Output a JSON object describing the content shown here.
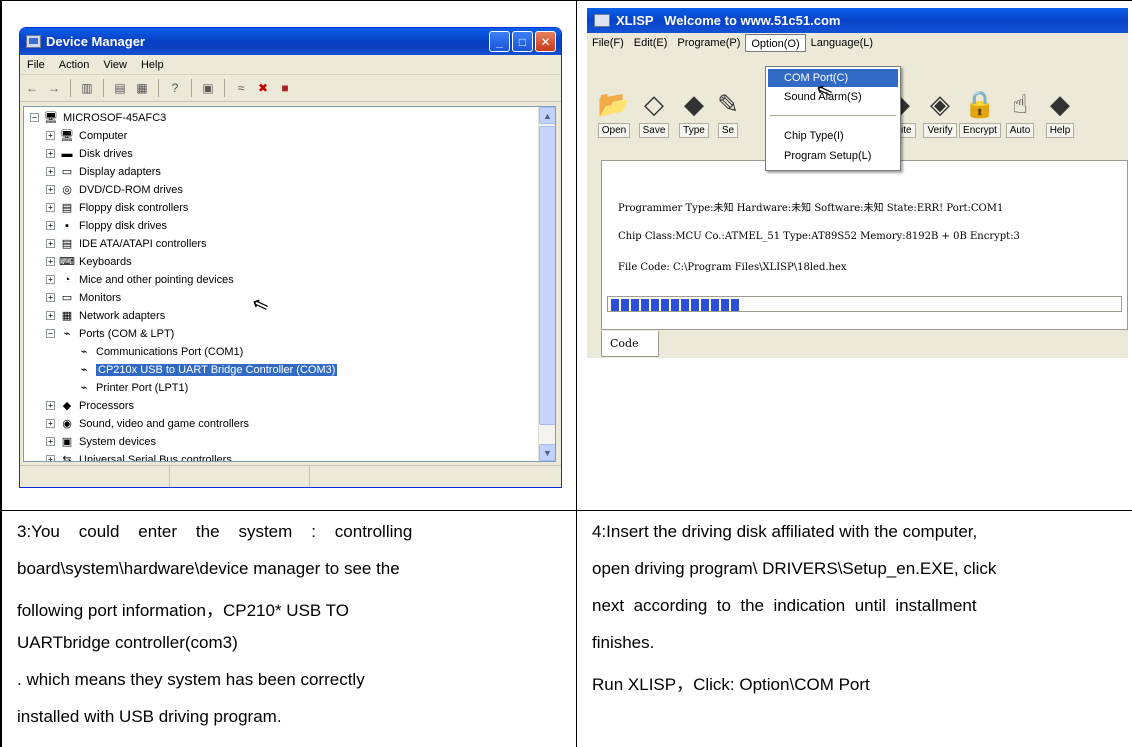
{
  "device_manager": {
    "title": "Device Manager",
    "menu": [
      "File",
      "Action",
      "View",
      "Help"
    ],
    "tree": {
      "root": "MICROSOF-45AFC3",
      "items": [
        {
          "label": "Computer",
          "icon": "computer-icon"
        },
        {
          "label": "Disk drives",
          "icon": "disk-icon"
        },
        {
          "label": "Display adapters",
          "icon": "monitor-icon"
        },
        {
          "label": "DVD/CD-ROM drives",
          "icon": "cd-icon"
        },
        {
          "label": "Floppy disk controllers",
          "icon": "controller-icon"
        },
        {
          "label": "Floppy disk drives",
          "icon": "floppy-icon"
        },
        {
          "label": "IDE ATA/ATAPI controllers",
          "icon": "controller-icon"
        },
        {
          "label": "Keyboards",
          "icon": "keyboard-icon"
        },
        {
          "label": "Mice and other pointing devices",
          "icon": "mouse-icon"
        },
        {
          "label": "Monitors",
          "icon": "monitor-icon"
        },
        {
          "label": "Network adapters",
          "icon": "network-icon"
        },
        {
          "label": "Ports (COM & LPT)",
          "icon": "port-icon"
        }
      ],
      "ports": [
        {
          "label": "Communications Port (COM1)"
        },
        {
          "label": "CP210x USB to UART Bridge Controller (COM3)",
          "selected": true
        },
        {
          "label": "Printer Port (LPT1)"
        }
      ],
      "after": [
        {
          "label": "Processors",
          "icon": "cpu-icon"
        },
        {
          "label": "Sound, video and game controllers",
          "icon": "sound-icon"
        },
        {
          "label": "System devices",
          "icon": "system-icon"
        },
        {
          "label": "Universal Serial Bus controllers",
          "icon": "usb-icon"
        }
      ]
    }
  },
  "xlisp": {
    "title": "XLISP   Welcome to www.51c51.com",
    "menu": [
      "File(F)",
      "Edit(E)",
      "Programe(P)",
      "Option(O)",
      "Language(L)"
    ],
    "toolbar": [
      "Open",
      "Save",
      "Type",
      "Se",
      "Write",
      "Verify",
      "Encrypt",
      "Auto",
      "Help"
    ],
    "option_menu": {
      "items": [
        "COM Port(C)",
        "Sound Alarm(S)",
        "Chip Type(I)",
        "Program Setup(L)"
      ]
    },
    "status": {
      "line1": "Programmer Type:未知 Hardware:未知 Software:未知 State:ERR! Port:COM1",
      "line2": "Chip Class:MCU Co.:ATMEL_51 Type:AT89S52 Memory:8192B + 0B Encrypt:3",
      "line3": "File Code: C:\\Program Files\\XLISP\\18led.hex"
    },
    "progress_blocks": 13,
    "tab": "Code"
  },
  "captions": {
    "left": [
      "3:You    could    enter    the    system    :    controlling",
      "board\\system\\hardware\\device manager to see the",
      "following port information，CP210* USB TO",
      "UARTbridge controller(com3)",
      ". which means they system has been correctly",
      "installed with USB driving program."
    ],
    "right": [
      "4:Insert the driving disk affiliated with the computer,",
      "open driving program\\ DRIVERS\\Setup_en.EXE, click",
      "next  according  to  the  indication  until  installment",
      "finishes.",
      "Run XLISP，Click: Option\\COM Port"
    ]
  }
}
